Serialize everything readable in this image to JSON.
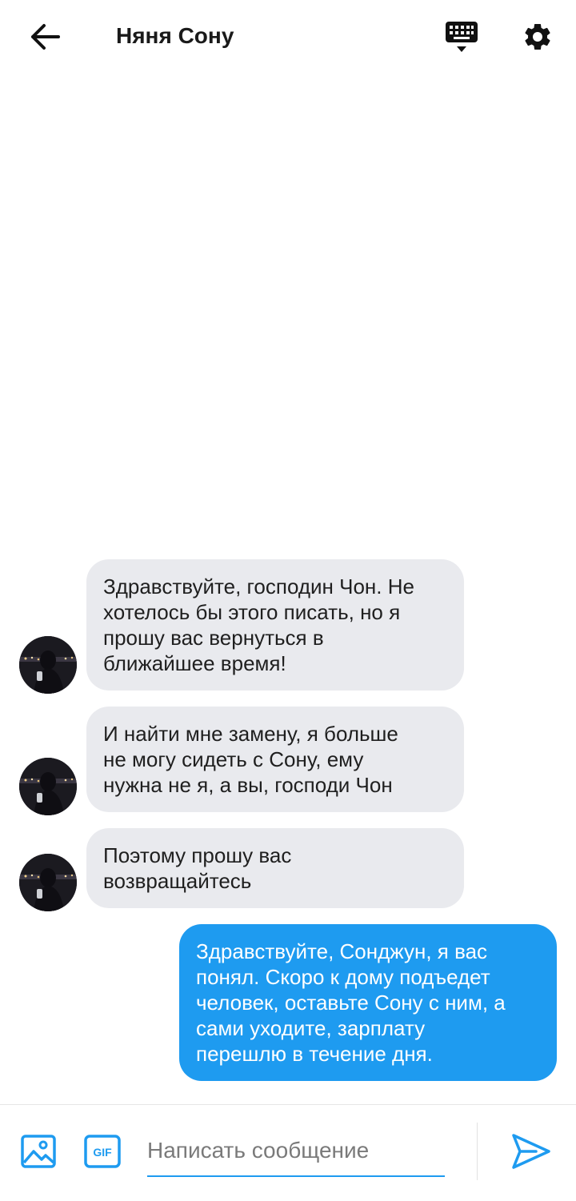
{
  "header": {
    "title": "Няня Сону"
  },
  "messages": [
    {
      "direction": "incoming",
      "lines": [
        "Здравствуйте, господин Чон. Не",
        "хотелось бы этого писать, но я",
        "прошу вас вернуться в",
        "ближайшее время!"
      ]
    },
    {
      "direction": "incoming",
      "lines": [
        "И найти мне замену, я больше",
        "не могу сидеть с Сону, ему",
        "нужна не я, а вы, господи Чон"
      ]
    },
    {
      "direction": "incoming",
      "lines": [
        "Поэтому прошу вас",
        "возвращайтесь"
      ]
    },
    {
      "direction": "outgoing",
      "lines": [
        "Здравствуйте, Сонджун, я вас",
        "понял. Скоро к дому подъедет",
        "человек, оставьте Сону с ним, а",
        "сами уходите, зарплату",
        "перешлю в течение дня."
      ]
    }
  ],
  "composer": {
    "placeholder": "Написать сообщение",
    "gif_label": "GIF"
  },
  "icons": {
    "back": "arrow-left-icon",
    "keyboard": "keyboard-icon",
    "settings": "gear-icon",
    "image": "image-icon",
    "gif": "gif-icon",
    "send": "send-icon"
  },
  "colors": {
    "accent": "#1e9bf0",
    "incoming_bubble": "#e9eaee",
    "outgoing_bubble": "#1e9bf0"
  }
}
